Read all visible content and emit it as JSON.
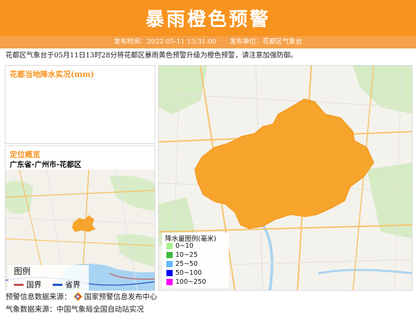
{
  "banner": {
    "title": "暴雨橙色预警",
    "publish_time": "发布时间：2022-05-11 13:31:00",
    "publisher": "发布单位：花都区气象台"
  },
  "summary": "花都区气象台于05月11日13时28分将花都区暴雨黄色预警升级为橙色预警，请注意加强防御。",
  "rain_panel": {
    "title": "花都当地降水实况(mm)"
  },
  "location_panel": {
    "title": "定位概览",
    "region": "广东省-广州市-花都区",
    "legend": {
      "title": "图例",
      "items": [
        {
          "label": "国界",
          "color": "#c0504d"
        },
        {
          "label": "省界",
          "color": "#1f4fbf"
        }
      ]
    }
  },
  "rain_legend": {
    "title": "降水量图例(毫米)",
    "items": [
      {
        "label": "0~10",
        "color": "#a6f28f"
      },
      {
        "label": "10~25",
        "color": "#3dba3d"
      },
      {
        "label": "25~50",
        "color": "#61b8ff"
      },
      {
        "label": "50~100",
        "color": "#0000fe"
      },
      {
        "label": "100~250",
        "color": "#fa00fa"
      }
    ]
  },
  "sources": {
    "alert_source": "预警信息数据来源：",
    "alert_center": "国家预警信息发布中心",
    "weather_source": "气象数据来源：中国气象局全国自动站实况"
  },
  "colors": {
    "accent": "#f7931e",
    "warning_area": "#f7a42c"
  }
}
